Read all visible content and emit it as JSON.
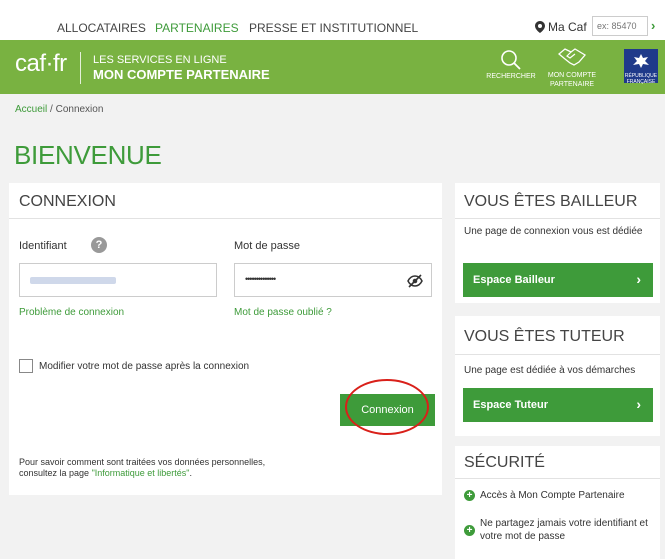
{
  "topnav": {
    "tabs": [
      {
        "label": "ALLOCATAIRES",
        "active": false
      },
      {
        "label": "PARTENAIRES",
        "active": true
      },
      {
        "label": "PRESSE ET INSTITUTIONNEL",
        "active": false
      }
    ],
    "macaf_label": "Ma Caf",
    "macaf_placeholder": "ex: 85470",
    "macaf_go": "›"
  },
  "banner": {
    "logo": "caf·fr",
    "line1": "LES SERVICES EN LIGNE",
    "line2": "MON COMPTE PARTENAIRE",
    "search_label": "RECHERCHER",
    "account_label_1": "MON COMPTE",
    "account_label_2": "PARTENAIRE",
    "rf_text": "RÉPUBLIQUE FRANÇAISE"
  },
  "breadcrumb": {
    "home": "Accueil",
    "sep": " / ",
    "current": "Connexion"
  },
  "page_title": "BIENVENUE",
  "login": {
    "title": "CONNEXION",
    "identifiant_label": "Identifiant",
    "help": "?",
    "password_label": "Mot de passe",
    "password_value": "••••••••••••••",
    "problem_link": "Problème de connexion",
    "forgot_link": "Mot de passe oublié ?",
    "checkbox_label": "Modifier votre mot de passe après la connexion",
    "submit_label": "Connexion",
    "privacy_text_1": "Pour savoir comment sont traitées vos données personnelles,",
    "privacy_text_2": "consultez la page ",
    "privacy_link": "\"Informatique et libertés\"",
    "privacy_end": "."
  },
  "bailleur": {
    "title": "VOUS ÊTES BAILLEUR",
    "text": "Une page de connexion vous est dédiée",
    "button": "Espace Bailleur"
  },
  "tuteur": {
    "title": "VOUS ÊTES TUTEUR",
    "text": "Une page est dédiée à vos démarches",
    "button": "Espace Tuteur"
  },
  "securite": {
    "title": "SÉCURITÉ",
    "items": [
      "Accès à Mon Compte Partenaire",
      "Ne partagez jamais votre identifiant et votre mot de passe"
    ]
  },
  "colors": {
    "green": "#3e9b3a",
    "banner_green": "#79b241",
    "highlight_red": "#d9201a"
  }
}
